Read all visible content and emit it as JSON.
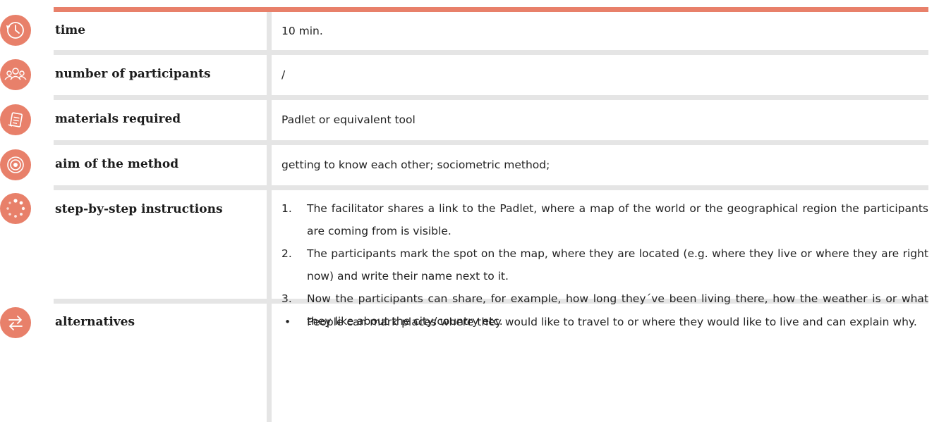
{
  "accent_color": "#e8806a",
  "divider_color": "#e5e5e5",
  "rows": {
    "time": {
      "icon": "clock-icon",
      "label": "time",
      "value": "10 min."
    },
    "participants": {
      "icon": "group-icon",
      "label": "number of participants",
      "value": "/"
    },
    "materials": {
      "icon": "document-icon",
      "label": "materials required",
      "value": "Padlet or equivalent tool"
    },
    "aim": {
      "icon": "target-icon",
      "label": "aim of the method",
      "value": "getting to know each other; sociometric method;"
    },
    "steps": {
      "icon": "dotted-circle-icon",
      "label": "step-by-step instructions",
      "items": [
        {
          "num": "1.",
          "text": "The facilitator shares a link to the Padlet, where a map of the world or the geographical region the participants are coming from is visible."
        },
        {
          "num": "2.",
          "text": "The participants mark the spot on the map, where they are located (e.g. where they live or where they are right now) and write their name next to it."
        },
        {
          "num": "3.",
          "text": "Now the participants can share, for example, how long they´ve been living there, how the weather is or what they like about the city/country etc."
        }
      ]
    },
    "alternatives": {
      "icon": "swap-arrows-icon",
      "label": "alternatives",
      "items": [
        {
          "bullet": "•",
          "text": "People can mark places where they would like to travel to or where they would like to live and can explain why."
        }
      ]
    }
  }
}
